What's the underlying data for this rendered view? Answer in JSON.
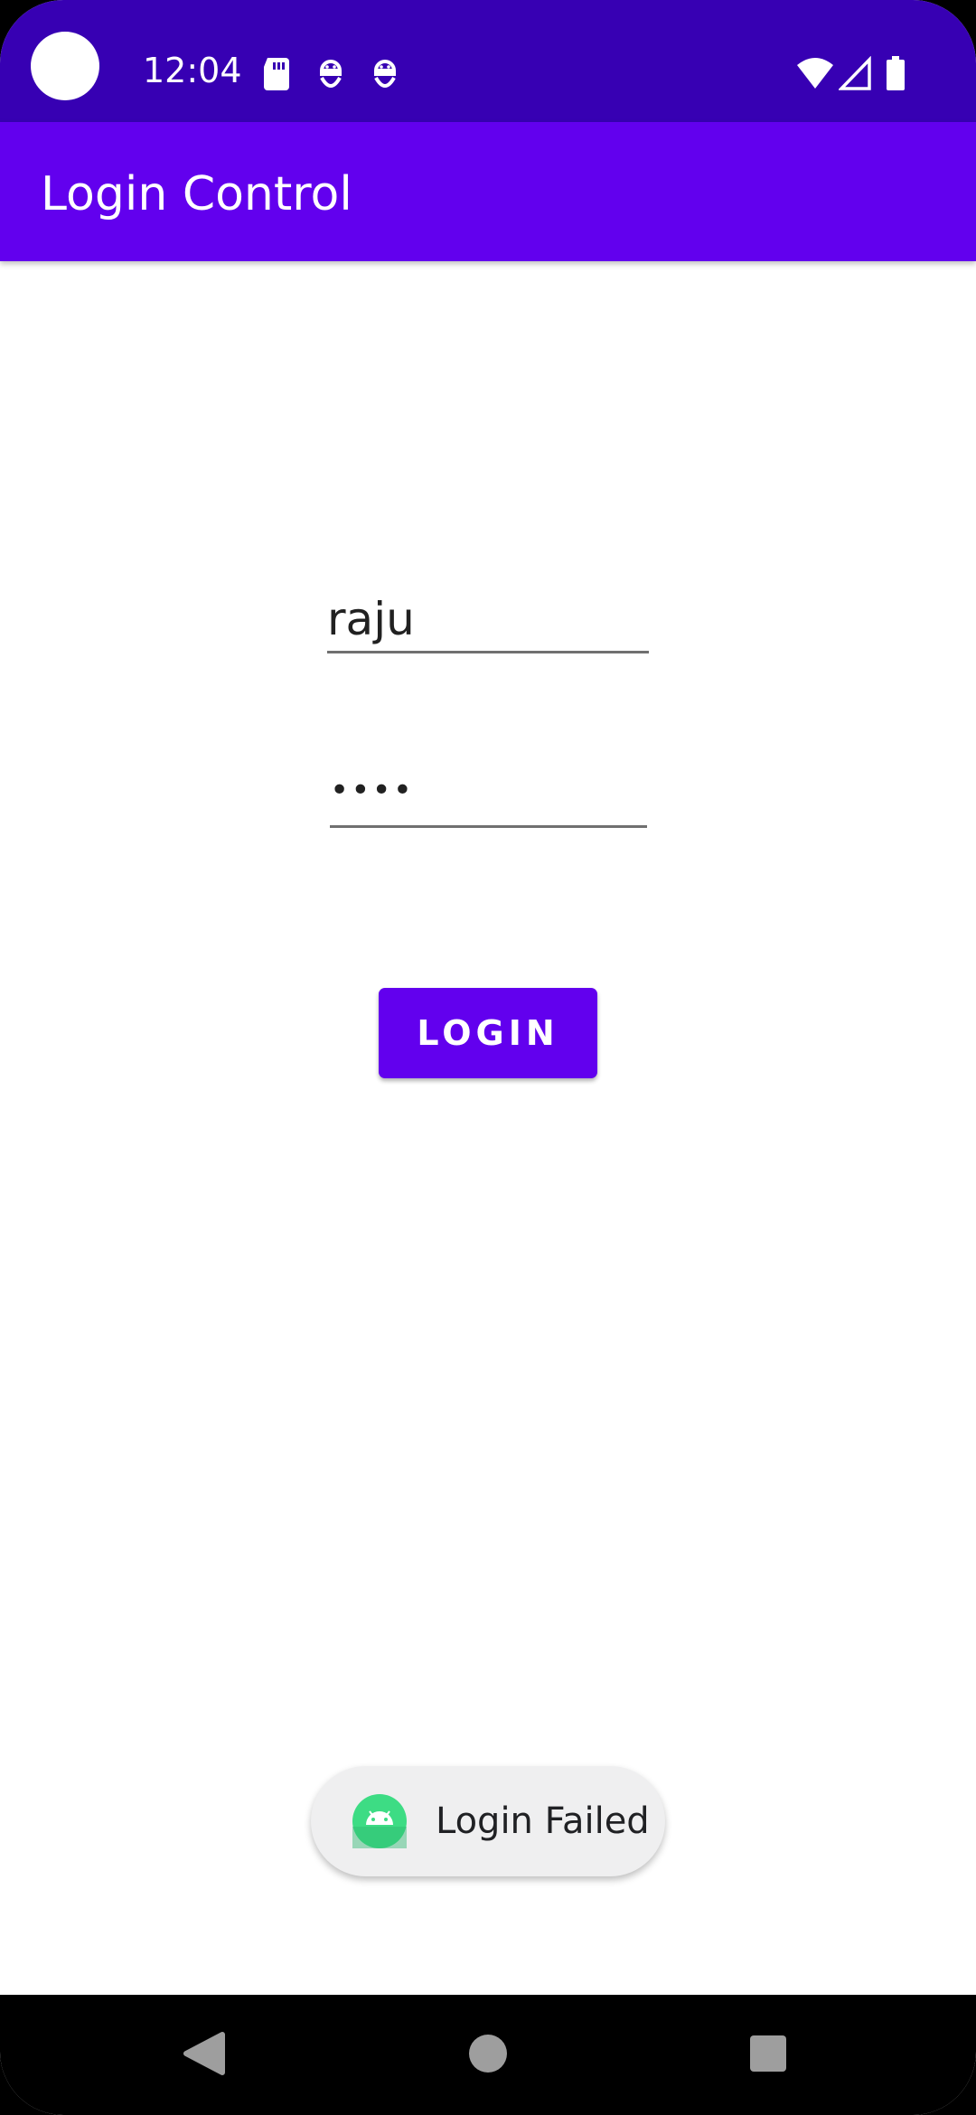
{
  "status_bar": {
    "time": "12:04",
    "icons": [
      "sd-card-icon",
      "android-debug-icon",
      "android-debug-icon",
      "wifi-icon",
      "cellular-signal-icon",
      "battery-icon"
    ]
  },
  "app_bar": {
    "title": "Login Control",
    "color": "#6200EE",
    "status_color": "#3700B3"
  },
  "form": {
    "username_value": "raju",
    "password_value": "••••",
    "login_button_label": "LOGIN"
  },
  "toast": {
    "icon": "android-app-icon",
    "message": "Login Failed"
  },
  "nav_bar": {
    "buttons": [
      "back-icon",
      "home-icon",
      "recents-icon"
    ]
  }
}
